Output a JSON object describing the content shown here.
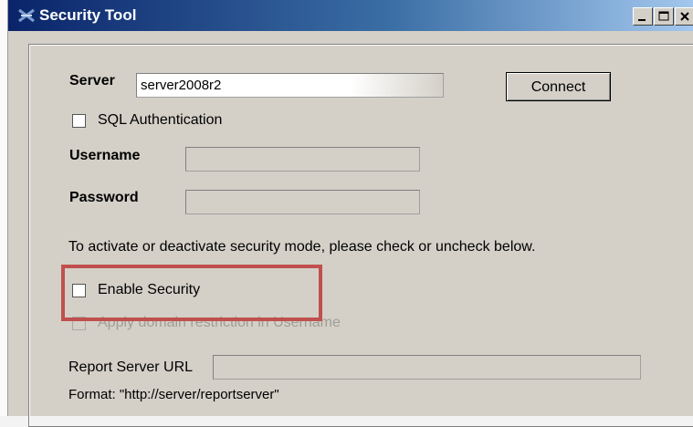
{
  "window": {
    "title": "Security Tool"
  },
  "server": {
    "label": "Server",
    "value": "server2008r2"
  },
  "connect_label": "Connect",
  "sql_auth": {
    "label": "SQL Authentication",
    "checked": false
  },
  "username": {
    "label": "Username",
    "value": ""
  },
  "password": {
    "label": "Password",
    "value": ""
  },
  "instruction": "To activate or deactivate security mode, please check or uncheck below.",
  "enable_security": {
    "label": "Enable Security",
    "checked": false
  },
  "domain_restriction": {
    "label": "Apply domain restriction in Username",
    "checked": false,
    "enabled": false
  },
  "report_url": {
    "label": "Report Server URL",
    "value": ""
  },
  "format_hint": "Format: \"http://server/reportserver\"",
  "colors": {
    "highlight": "#c0504d",
    "titlebar_start": "#0a246a",
    "titlebar_end": "#a6caf0"
  },
  "icons": [
    "app-icon",
    "minimize-icon",
    "maximize-icon",
    "close-icon"
  ]
}
